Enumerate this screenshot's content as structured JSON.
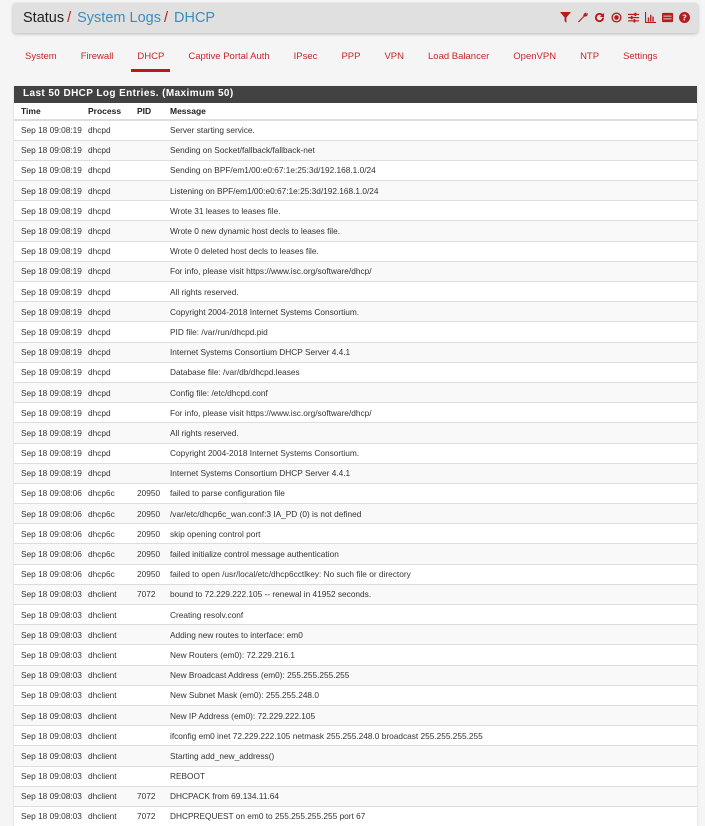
{
  "breadcrumb": {
    "root": "Status",
    "items": [
      "System Logs",
      "DHCP"
    ],
    "separator": "/"
  },
  "header_icons": [
    "filter-icon",
    "wrench-icon",
    "refresh-icon",
    "stop-circle-icon",
    "sliders-icon",
    "bar-chart-icon",
    "list-icon",
    "help-icon"
  ],
  "colors": {
    "accent": "#b71c1c",
    "link": "#3c8dbc",
    "heading_bg": "#424242"
  },
  "tabs": [
    {
      "label": "System",
      "active": false
    },
    {
      "label": "Firewall",
      "active": false
    },
    {
      "label": "DHCP",
      "active": true
    },
    {
      "label": "Captive Portal Auth",
      "active": false
    },
    {
      "label": "IPsec",
      "active": false
    },
    {
      "label": "PPP",
      "active": false
    },
    {
      "label": "VPN",
      "active": false
    },
    {
      "label": "Load Balancer",
      "active": false
    },
    {
      "label": "OpenVPN",
      "active": false
    },
    {
      "label": "NTP",
      "active": false
    },
    {
      "label": "Settings",
      "active": false
    }
  ],
  "panel": {
    "title": "Last 50 DHCP Log Entries. (Maximum 50)",
    "columns": [
      "Time",
      "Process",
      "PID",
      "Message"
    ],
    "rows": [
      [
        "Sep 18 09:08:19",
        "dhcpd",
        "",
        "Server starting service."
      ],
      [
        "Sep 18 09:08:19",
        "dhcpd",
        "",
        "Sending on Socket/fallback/fallback-net"
      ],
      [
        "Sep 18 09:08:19",
        "dhcpd",
        "",
        "Sending on BPF/em1/00:e0:67:1e:25:3d/192.168.1.0/24"
      ],
      [
        "Sep 18 09:08:19",
        "dhcpd",
        "",
        "Listening on BPF/em1/00:e0:67:1e:25:3d/192.168.1.0/24"
      ],
      [
        "Sep 18 09:08:19",
        "dhcpd",
        "",
        "Wrote 31 leases to leases file."
      ],
      [
        "Sep 18 09:08:19",
        "dhcpd",
        "",
        "Wrote 0 new dynamic host decls to leases file."
      ],
      [
        "Sep 18 09:08:19",
        "dhcpd",
        "",
        "Wrote 0 deleted host decls to leases file."
      ],
      [
        "Sep 18 09:08:19",
        "dhcpd",
        "",
        "For info, please visit https://www.isc.org/software/dhcp/"
      ],
      [
        "Sep 18 09:08:19",
        "dhcpd",
        "",
        "All rights reserved."
      ],
      [
        "Sep 18 09:08:19",
        "dhcpd",
        "",
        "Copyright 2004-2018 Internet Systems Consortium."
      ],
      [
        "Sep 18 09:08:19",
        "dhcpd",
        "",
        "PID file: /var/run/dhcpd.pid"
      ],
      [
        "Sep 18 09:08:19",
        "dhcpd",
        "",
        "Internet Systems Consortium DHCP Server 4.4.1"
      ],
      [
        "Sep 18 09:08:19",
        "dhcpd",
        "",
        "Database file: /var/db/dhcpd.leases"
      ],
      [
        "Sep 18 09:08:19",
        "dhcpd",
        "",
        "Config file: /etc/dhcpd.conf"
      ],
      [
        "Sep 18 09:08:19",
        "dhcpd",
        "",
        "For info, please visit https://www.isc.org/software/dhcp/"
      ],
      [
        "Sep 18 09:08:19",
        "dhcpd",
        "",
        "All rights reserved."
      ],
      [
        "Sep 18 09:08:19",
        "dhcpd",
        "",
        "Copyright 2004-2018 Internet Systems Consortium."
      ],
      [
        "Sep 18 09:08:19",
        "dhcpd",
        "",
        "Internet Systems Consortium DHCP Server 4.4.1"
      ],
      [
        "Sep 18 09:08:06",
        "dhcp6c",
        "20950",
        "failed to parse configuration file"
      ],
      [
        "Sep 18 09:08:06",
        "dhcp6c",
        "20950",
        "/var/etc/dhcp6c_wan.conf:3 IA_PD (0) is not defined"
      ],
      [
        "Sep 18 09:08:06",
        "dhcp6c",
        "20950",
        "skip opening control port"
      ],
      [
        "Sep 18 09:08:06",
        "dhcp6c",
        "20950",
        "failed initialize control message authentication"
      ],
      [
        "Sep 18 09:08:06",
        "dhcp6c",
        "20950",
        "failed to open /usr/local/etc/dhcp6cctlkey: No such file or directory"
      ],
      [
        "Sep 18 09:08:03",
        "dhclient",
        "7072",
        "bound to 72.229.222.105 -- renewal in 41952 seconds."
      ],
      [
        "Sep 18 09:08:03",
        "dhclient",
        "",
        "Creating resolv.conf"
      ],
      [
        "Sep 18 09:08:03",
        "dhclient",
        "",
        "Adding new routes to interface: em0"
      ],
      [
        "Sep 18 09:08:03",
        "dhclient",
        "",
        "New Routers (em0): 72.229.216.1"
      ],
      [
        "Sep 18 09:08:03",
        "dhclient",
        "",
        "New Broadcast Address (em0): 255.255.255.255"
      ],
      [
        "Sep 18 09:08:03",
        "dhclient",
        "",
        "New Subnet Mask (em0): 255.255.248.0"
      ],
      [
        "Sep 18 09:08:03",
        "dhclient",
        "",
        "New IP Address (em0): 72.229.222.105"
      ],
      [
        "Sep 18 09:08:03",
        "dhclient",
        "",
        "ifconfig em0 inet 72.229.222.105 netmask 255.255.248.0 broadcast 255.255.255.255"
      ],
      [
        "Sep 18 09:08:03",
        "dhclient",
        "",
        "Starting add_new_address()"
      ],
      [
        "Sep 18 09:08:03",
        "dhclient",
        "",
        "REBOOT"
      ],
      [
        "Sep 18 09:08:03",
        "dhclient",
        "7072",
        "DHCPACK from 69.134.11.64"
      ],
      [
        "Sep 18 09:08:03",
        "dhclient",
        "7072",
        "DHCPREQUEST on em0 to 255.255.255.255 port 67"
      ]
    ]
  }
}
